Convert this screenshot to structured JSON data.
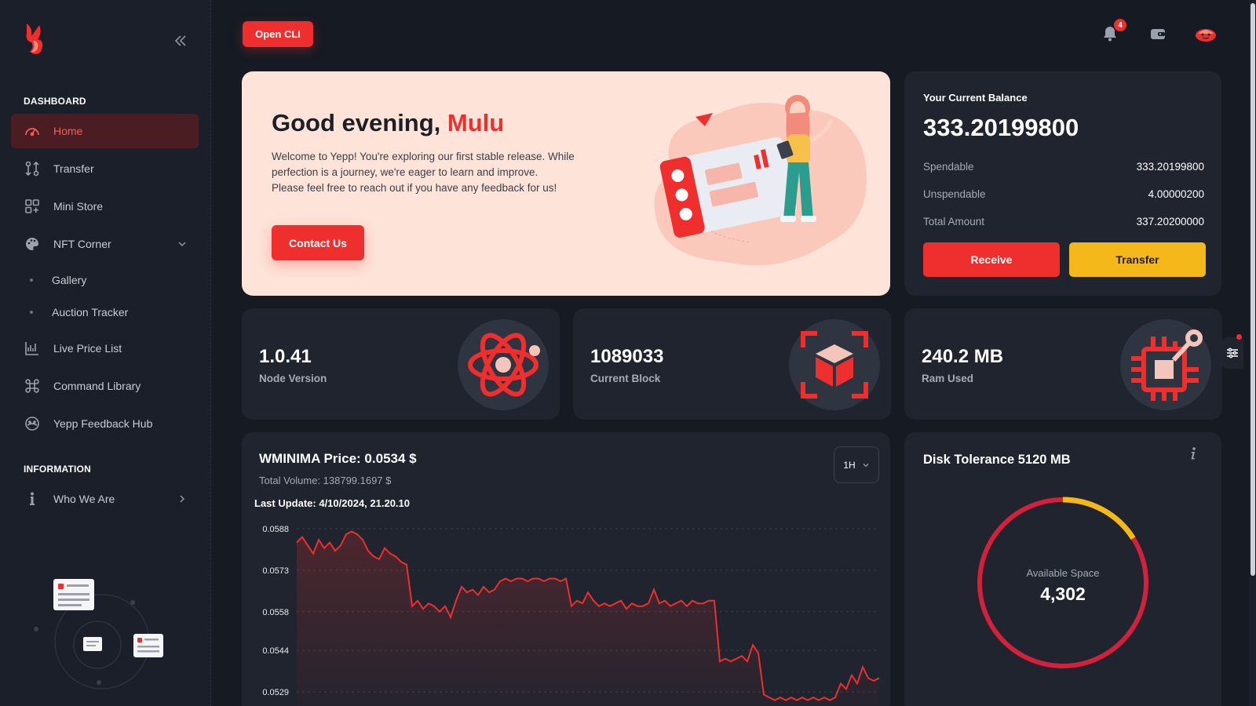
{
  "sidebar": {
    "dashboard_title": "DASHBOARD",
    "items": [
      {
        "label": "Home",
        "icon": "gauge-icon"
      },
      {
        "label": "Transfer",
        "icon": "transfer-icon"
      },
      {
        "label": "Mini Store",
        "icon": "grid-icon"
      },
      {
        "label": "NFT Corner",
        "icon": "palette-icon"
      },
      {
        "label": "Gallery"
      },
      {
        "label": "Auction Tracker"
      },
      {
        "label": "Live Price List",
        "icon": "chart-icon"
      },
      {
        "label": "Command Library",
        "icon": "command-icon"
      },
      {
        "label": "Yepp Feedback Hub",
        "icon": "feedback-icon"
      }
    ],
    "information_title": "INFORMATION",
    "info_items": [
      {
        "label": "Who We Are",
        "icon": "info-icon"
      }
    ]
  },
  "topbar": {
    "open_cli": "Open CLI",
    "notifications_count": "4"
  },
  "welcome": {
    "greeting": "Good evening,",
    "name": "Mulu",
    "line1": "Welcome to Yepp! You're exploring our first stable release. While",
    "line2": "perfection is a journey, we're eager to learn and improve.",
    "line3": "Please feel free to reach out if you have any feedback for us!",
    "contact_button": "Contact Us"
  },
  "balance": {
    "label": "Your Current Balance",
    "amount": "333.20199800",
    "rows": [
      {
        "key": "Spendable",
        "value": "333.20199800"
      },
      {
        "key": "Unspendable",
        "value": "4.00000200"
      },
      {
        "key": "Total Amount",
        "value": "337.20200000"
      }
    ],
    "receive": "Receive",
    "transfer": "Transfer"
  },
  "stats": [
    {
      "value": "1.0.41",
      "label": "Node Version",
      "icon": "atom-icon"
    },
    {
      "value": "1089033",
      "label": "Current Block",
      "icon": "cube-icon"
    },
    {
      "value": "240.2 MB",
      "label": "Ram Used",
      "icon": "chip-icon"
    }
  ],
  "price": {
    "title": "WMINIMA Price: 0.0534 $",
    "volume": "Total Volume: 138799.1697 $",
    "last_update": "Last Update: 4/10/2024, 21.20.10",
    "timeframe": "1H"
  },
  "chart_data": {
    "type": "line",
    "title": "",
    "xlabel": "",
    "ylabel": "",
    "ylim": [
      0.0529,
      0.0588
    ],
    "ytick_labels": [
      "0.0588",
      "0.0573",
      "0.0558",
      "0.0544",
      "0.0529"
    ],
    "series": [
      {
        "color": "#ef2e2e",
        "values": [
          0.0583,
          0.0585,
          0.0582,
          0.0579,
          0.0584,
          0.0581,
          0.0583,
          0.058,
          0.0582,
          0.0586,
          0.0587,
          0.0586,
          0.0584,
          0.058,
          0.0578,
          0.0577,
          0.0581,
          0.0579,
          0.0578,
          0.0576,
          0.0575,
          0.056,
          0.0562,
          0.0559,
          0.0561,
          0.056,
          0.0558,
          0.056,
          0.0556,
          0.0562,
          0.0567,
          0.0565,
          0.0566,
          0.0564,
          0.0567,
          0.0565,
          0.0566,
          0.0569,
          0.057,
          0.0569,
          0.057,
          0.057,
          0.0569,
          0.057,
          0.057,
          0.0569,
          0.057,
          0.057,
          0.0569,
          0.057,
          0.056,
          0.0562,
          0.0561,
          0.0565,
          0.0562,
          0.056,
          0.0561,
          0.056,
          0.0561,
          0.0562,
          0.0559,
          0.0561,
          0.056,
          0.056,
          0.0561,
          0.0566,
          0.0561,
          0.0562,
          0.056,
          0.0561,
          0.0562,
          0.056,
          0.0562,
          0.0561,
          0.0561,
          0.0562,
          0.0562,
          0.054,
          0.0541,
          0.054,
          0.0541,
          0.0542,
          0.054,
          0.0546,
          0.0543,
          0.0528,
          0.0527,
          0.0526,
          0.0527,
          0.0526,
          0.0527,
          0.0526,
          0.0527,
          0.0526,
          0.0527,
          0.0526,
          0.0527,
          0.0526,
          0.0527,
          0.0532,
          0.053,
          0.0535,
          0.0532,
          0.0538,
          0.0534,
          0.0533,
          0.0534
        ]
      }
    ],
    "grid": true
  },
  "disk": {
    "title": "Disk Tolerance 5120 MB",
    "center_label": "Available Space",
    "center_value": "4,302",
    "total_mb": 5120,
    "used_fraction": 0.16,
    "used_color": "#f5b81b",
    "free_color": "#d4213b"
  },
  "colors": {
    "accent": "#ef2e2e",
    "yellow": "#f5b81b",
    "bg": "#151a23",
    "card": "#1f242e"
  }
}
